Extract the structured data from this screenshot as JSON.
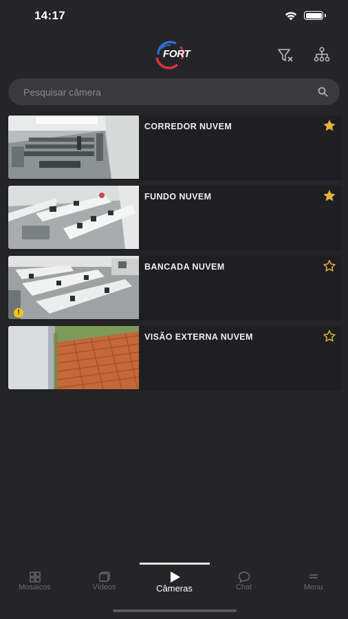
{
  "status_bar": {
    "time": "14:17"
  },
  "header": {
    "logo_text": "FORT"
  },
  "search": {
    "placeholder": "Pesquisar câmera"
  },
  "cameras": [
    {
      "name": "CORREDOR NUVEM",
      "favorite": true,
      "warning": false
    },
    {
      "name": "FUNDO NUVEM",
      "favorite": true,
      "warning": false
    },
    {
      "name": "BANCADA NUVEM",
      "favorite": false,
      "warning": true
    },
    {
      "name": "VISÃO EXTERNA NUVEM",
      "favorite": false,
      "warning": false
    }
  ],
  "tabs": [
    {
      "label": "Mosaicos",
      "icon": "grid-icon",
      "active": false
    },
    {
      "label": "Vídeos",
      "icon": "videos-icon",
      "active": false
    },
    {
      "label": "Câmeras",
      "icon": "play-icon",
      "active": true
    },
    {
      "label": "Chat",
      "icon": "chat-icon",
      "active": false
    },
    {
      "label": "Menu",
      "icon": "menu-icon",
      "active": false
    }
  ],
  "colors": {
    "background": "#252528",
    "card": "#1f1f22",
    "star_gold": "#e8b23a",
    "logo_blue": "#2d6fd6",
    "logo_red": "#e0323c"
  }
}
